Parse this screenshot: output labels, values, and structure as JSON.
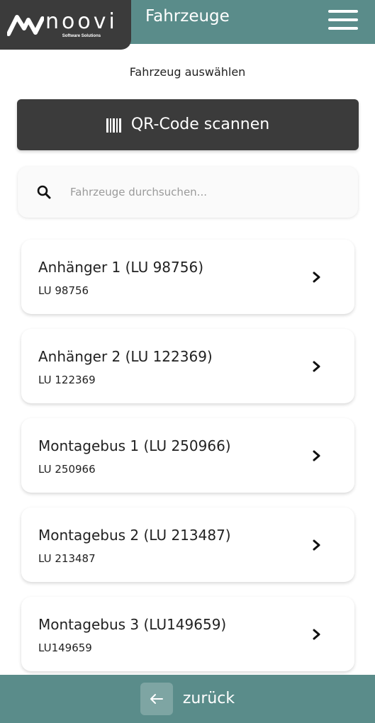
{
  "header": {
    "logo_text": "noovi",
    "logo_subtitle": "Software Solutions",
    "title": "Fahrzeuge",
    "menu_icon": "hamburger-menu-icon"
  },
  "subtitle": "Fahrzeug auswählen",
  "qr_button": {
    "icon": "barcode-icon",
    "label": "QR-Code scannen"
  },
  "search": {
    "icon": "search-icon",
    "placeholder": "Fahrzeuge durchsuchen..."
  },
  "vehicles": [
    {
      "name": "Anhänger 1 (LU 98756)",
      "plate": "LU 98756"
    },
    {
      "name": "Anhänger 2 (LU 122369)",
      "plate": "LU 122369"
    },
    {
      "name": "Montagebus 1 (LU 250966)",
      "plate": "LU 250966"
    },
    {
      "name": "Montagebus 2 (LU 213487)",
      "plate": "LU 213487"
    },
    {
      "name": "Montagebus 3 (LU149659)",
      "plate": "LU149659"
    }
  ],
  "footer": {
    "back_icon": "arrow-left-icon",
    "back_label": "zurück"
  },
  "colors": {
    "primary": "#5a8c8a",
    "dark": "#3b3b3b",
    "white": "#ffffff"
  }
}
